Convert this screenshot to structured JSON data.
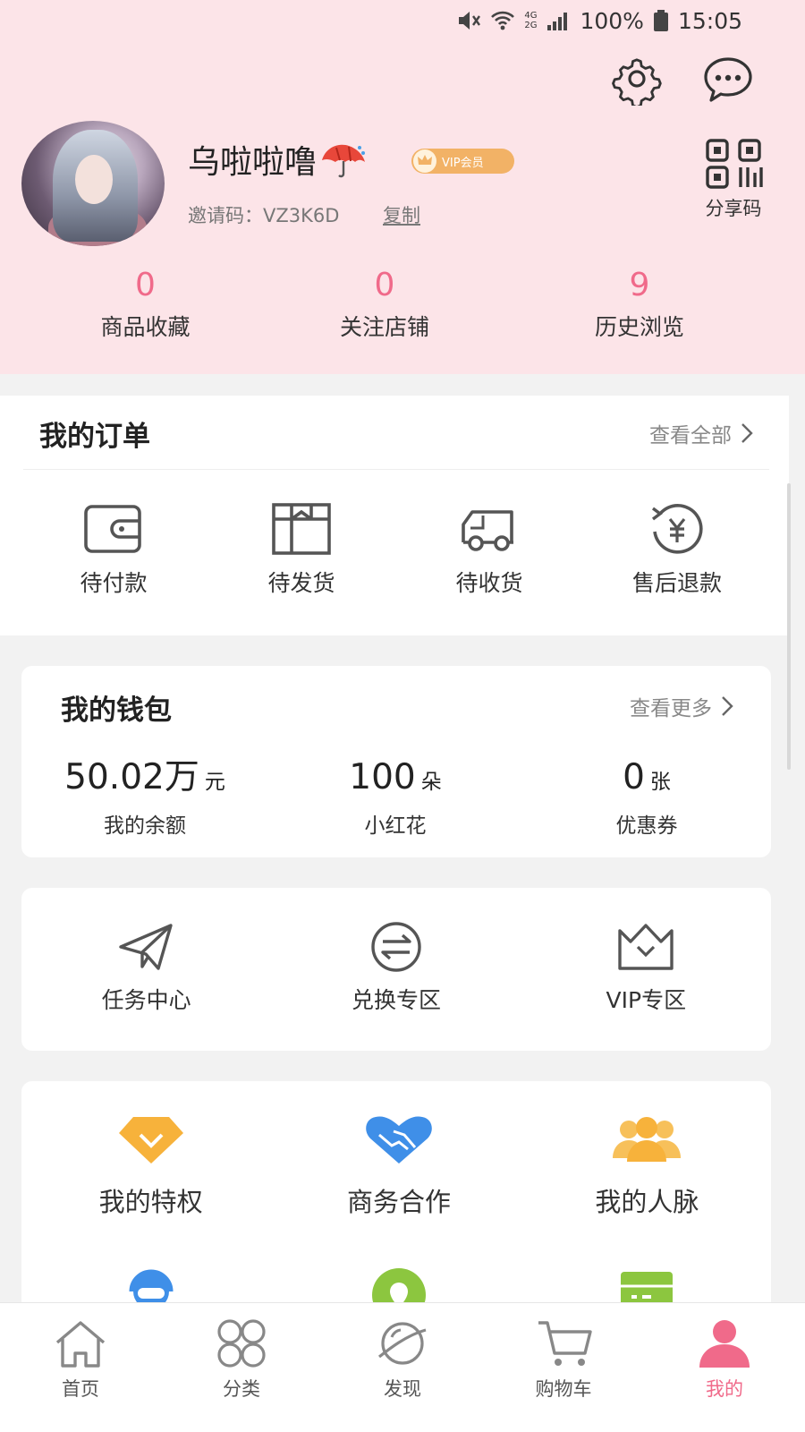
{
  "status_bar": {
    "battery": "100%",
    "time": "15:05",
    "net1": "4G",
    "net2": "2G"
  },
  "profile": {
    "username": "乌啦啦噜",
    "vip_label": "VIP会员",
    "invite_label": "邀请码：VZ3K6D",
    "copy_label": "复制",
    "share_code_label": "分享码"
  },
  "stats": [
    {
      "value": "0",
      "label": "商品收藏"
    },
    {
      "value": "0",
      "label": "关注店铺"
    },
    {
      "value": "9",
      "label": "历史浏览"
    }
  ],
  "orders": {
    "title": "我的订单",
    "view_all": "查看全部",
    "items": [
      {
        "label": "待付款",
        "icon": "wallet-icon"
      },
      {
        "label": "待发货",
        "icon": "box-icon"
      },
      {
        "label": "待收货",
        "icon": "truck-icon"
      },
      {
        "label": "售后退款",
        "icon": "refund-yen-icon"
      }
    ]
  },
  "wallet": {
    "title": "我的钱包",
    "view_more": "查看更多",
    "items": [
      {
        "value": "50.02万",
        "unit": "元",
        "label": "我的余额"
      },
      {
        "value": "100",
        "unit": "朵",
        "label": "小红花"
      },
      {
        "value": "0",
        "unit": "张",
        "label": "优惠券"
      }
    ]
  },
  "quick": [
    {
      "label": "任务中心",
      "icon": "paper-plane-icon"
    },
    {
      "label": "兑换专区",
      "icon": "exchange-icon"
    },
    {
      "label": "VIP专区",
      "icon": "crown-icon"
    }
  ],
  "services": [
    {
      "label": "我的特权",
      "icon": "diamond-icon",
      "color": "#f7b23b"
    },
    {
      "label": "商务合作",
      "icon": "handshake-icon",
      "color": "#3f8fe8"
    },
    {
      "label": "我的人脉",
      "icon": "people-icon",
      "color": "#f7b23b"
    }
  ],
  "nav": [
    {
      "label": "首页",
      "icon": "home-icon"
    },
    {
      "label": "分类",
      "icon": "category-icon"
    },
    {
      "label": "发现",
      "icon": "planet-icon"
    },
    {
      "label": "购物车",
      "icon": "cart-icon"
    },
    {
      "label": "我的",
      "icon": "person-icon",
      "active": true
    }
  ],
  "colors": {
    "accent": "#f06a8a",
    "header_bg": "#fce4e8",
    "vip": "#f2b266",
    "service_yellow": "#f7b23b",
    "service_blue": "#3f8fe8",
    "service_green": "#8cc63f"
  }
}
